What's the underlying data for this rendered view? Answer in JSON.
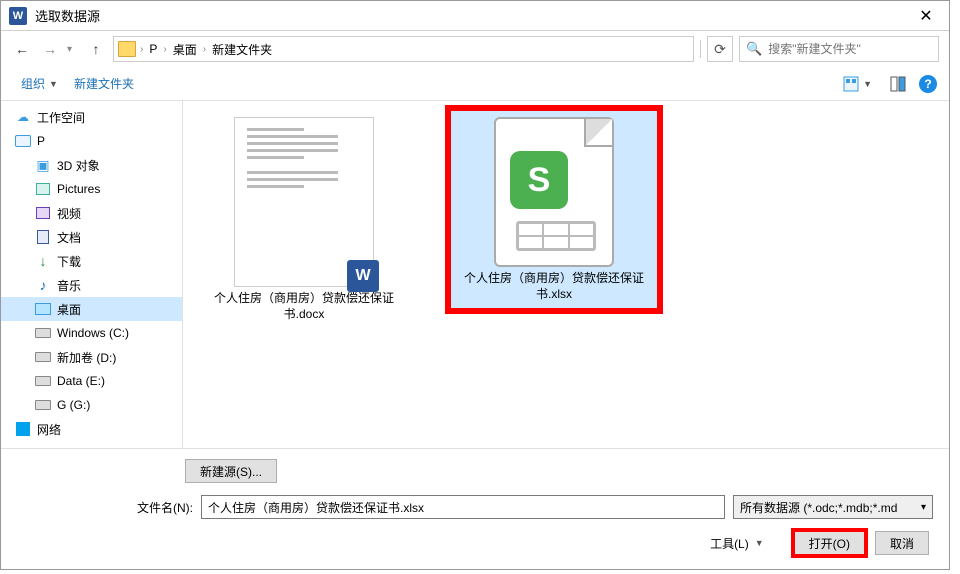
{
  "window": {
    "title": "选取数据源"
  },
  "breadcrumbs": {
    "root": "P",
    "mid": "桌面",
    "leaf": "新建文件夹"
  },
  "search": {
    "placeholder": "搜索\"新建文件夹\""
  },
  "toolbar": {
    "organize": "组织",
    "new_folder": "新建文件夹"
  },
  "sidebar": {
    "workspace": "工作空间",
    "p": "P",
    "threed": "3D 对象",
    "pictures": "Pictures",
    "video": "视频",
    "docs": "文档",
    "downloads": "下载",
    "music": "音乐",
    "desktop": "桌面",
    "win_c": "Windows (C:)",
    "new_d": "新加卷 (D:)",
    "data_e": "Data (E:)",
    "g_g": "G (G:)",
    "network": "网络"
  },
  "files": {
    "docx": "个人住房（商用房）贷款偿还保证书.docx",
    "xlsx": "个人住房（商用房）贷款偿还保证书.xlsx"
  },
  "footer": {
    "new_source": "新建源(S)...",
    "filename_label": "文件名(N):",
    "filename_value": "个人住房（商用房）贷款偿还保证书.xlsx",
    "filetype": "所有数据源 (*.odc;*.mdb;*.md",
    "tools": "工具(L)",
    "open": "打开(O)",
    "cancel": "取消"
  }
}
